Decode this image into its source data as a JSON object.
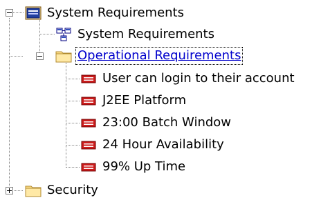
{
  "tree": {
    "root": {
      "label": "System Requirements",
      "icon": "package-icon",
      "expanded": true
    },
    "diagram": {
      "label": "System Requirements",
      "icon": "diagram-icon"
    },
    "operational": {
      "label": "Operational Requirements",
      "icon": "folder-icon",
      "expanded": true,
      "selected": true,
      "items": [
        {
          "label": "User can login to their account",
          "icon": "requirement-icon"
        },
        {
          "label": "J2EE Platform",
          "icon": "requirement-icon"
        },
        {
          "label": "23:00 Batch Window",
          "icon": "requirement-icon"
        },
        {
          "label": "24 Hour Availability",
          "icon": "requirement-icon"
        },
        {
          "label": "99% Up Time",
          "icon": "requirement-icon"
        }
      ]
    },
    "security": {
      "label": "Security",
      "icon": "folder-icon",
      "expanded": false
    }
  },
  "colors": {
    "selected_text": "#0000cc",
    "requirement_icon": "#cc0000",
    "folder": "#ffe08a",
    "tree_lines": "#808080"
  }
}
